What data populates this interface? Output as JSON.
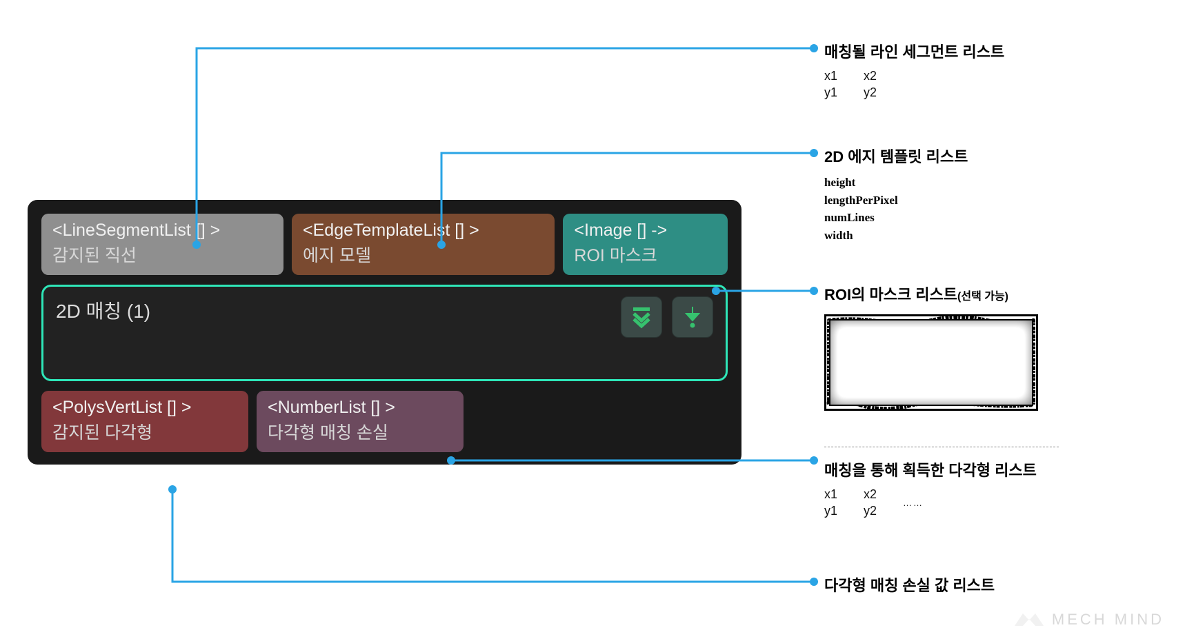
{
  "node": {
    "title": "2D 매칭 (1)",
    "inputs": {
      "lineSegment": {
        "type": "<LineSegmentList [] >",
        "label": "감지된 직선"
      },
      "edgeTemplate": {
        "type": "<EdgeTemplateList [] >",
        "label": "에지 모델"
      },
      "image": {
        "type": "<Image [] ->",
        "label": "ROI 마스크"
      }
    },
    "outputs": {
      "polys": {
        "type": "<PolysVertList [] >",
        "label": "감지된 다각형"
      },
      "number": {
        "type": "<NumberList [] >",
        "label": "다각형 매칭 손실"
      }
    }
  },
  "annotations": {
    "a1": {
      "title": "매칭될 라인 세그먼트 리스트",
      "coords": {
        "c1": [
          "x1",
          "y1"
        ],
        "c2": [
          "x2",
          "y2"
        ]
      }
    },
    "a2": {
      "title": "2D 에지 템플릿 리스트",
      "fields": [
        "height",
        "lengthPerPixel",
        "numLines",
        "width"
      ]
    },
    "a3": {
      "title": "ROI의 마스크 리스트",
      "title_sub": "(선택 가능)"
    },
    "a4": {
      "title": "매칭을 통해 획득한 다각형 리스트",
      "coords": {
        "c1": [
          "x1",
          "y1"
        ],
        "c2": [
          "x2",
          "y2"
        ],
        "more": "……"
      }
    },
    "a5": {
      "title": "다각형 매칭 손실 값 리스트"
    }
  },
  "brand": "MECH MIND"
}
